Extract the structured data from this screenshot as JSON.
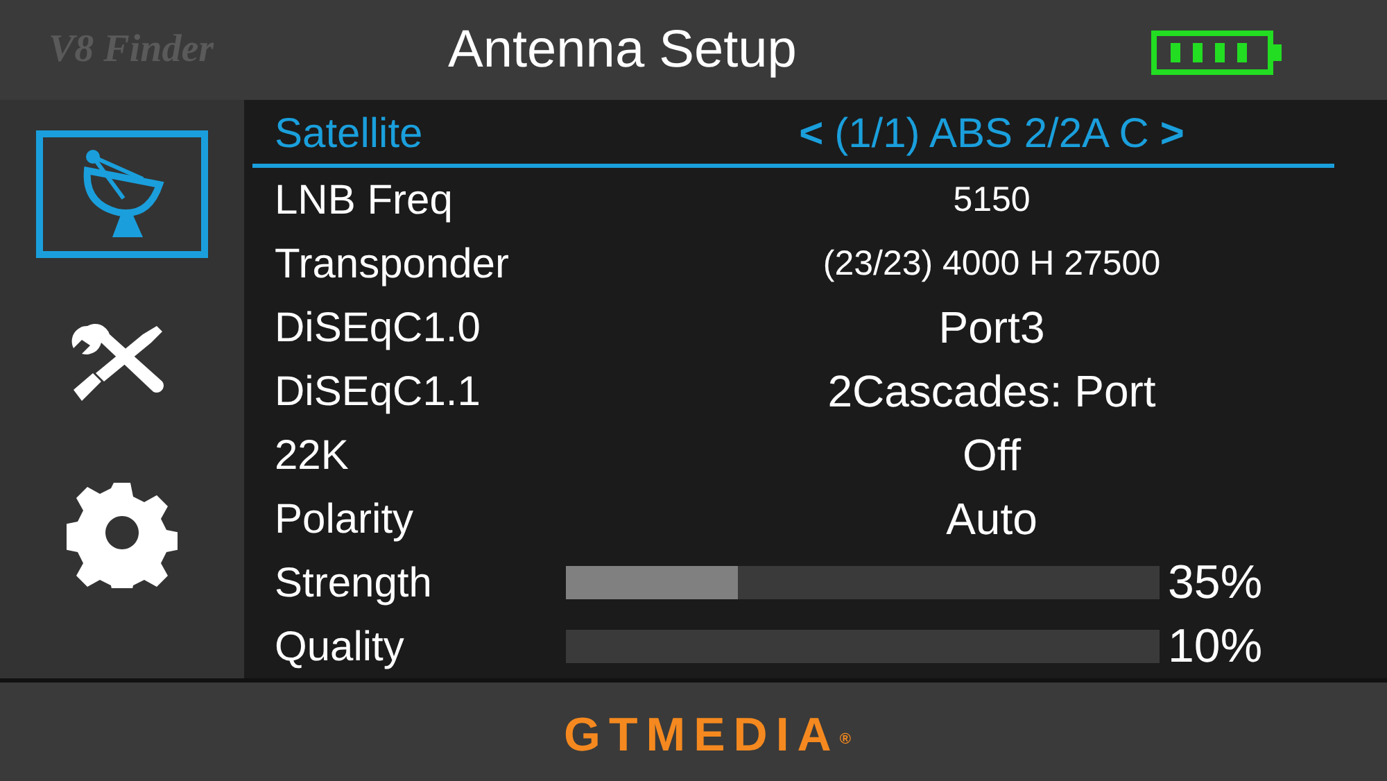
{
  "header": {
    "logo": "V8 Finder",
    "title": "Antenna Setup"
  },
  "sidebar": {
    "items": [
      {
        "kind": "dish",
        "selected": true
      },
      {
        "kind": "tools",
        "selected": false
      },
      {
        "kind": "gear",
        "selected": false
      }
    ]
  },
  "rows": [
    {
      "kind": "selector",
      "label": "Satellite",
      "left": "<",
      "value": "(1/1) ABS 2/2A C",
      "right": ">",
      "selected": true
    },
    {
      "kind": "value",
      "label": "LNB Freq",
      "value": "5150",
      "small": true,
      "selected": false
    },
    {
      "kind": "value",
      "label": "Transponder",
      "value": "(23/23) 4000 H 27500",
      "small": true,
      "selected": false
    },
    {
      "kind": "value",
      "label": "DiSEqC1.0",
      "value": "Port3",
      "small": false,
      "selected": false
    },
    {
      "kind": "value",
      "label": "DiSEqC1.1",
      "value": "2Cascades: Port",
      "small": false,
      "selected": false
    },
    {
      "kind": "value",
      "label": "22K",
      "value": "Off",
      "small": false,
      "selected": false
    },
    {
      "kind": "value",
      "label": "Polarity",
      "value": "Auto",
      "small": false,
      "selected": false
    },
    {
      "kind": "meter",
      "label": "Strength",
      "level": 0.29,
      "reading": "35%",
      "selected": false
    },
    {
      "kind": "meter",
      "label": "Quality",
      "level": 0,
      "reading": "10%",
      "selected": false
    }
  ],
  "footer": {
    "brand": "GTMEDIA",
    "mark": "®"
  }
}
